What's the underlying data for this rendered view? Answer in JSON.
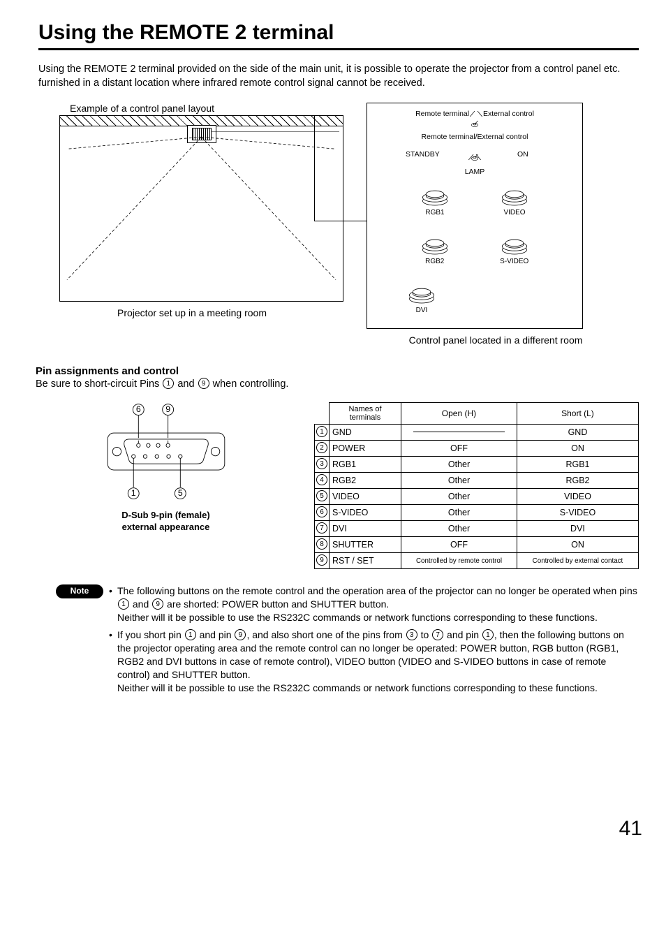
{
  "title": "Using the REMOTE 2 terminal",
  "intro": "Using the REMOTE 2 terminal provided on the side of the main unit, it is possible to operate the projector from a control panel etc. furnished in a distant location where infrared remote control signal cannot be received.",
  "example_label": "Example of a control panel layout",
  "left_caption": "Projector set up in a meeting room",
  "right_caption": "Control panel located in a different room",
  "panel": {
    "top1_left": "Remote terminal",
    "top1_right": "External control",
    "top2": "Remote terminal/External control",
    "standby": "STANDBY",
    "on": "ON",
    "lamp": "LAMP",
    "buttons": [
      "RGB1",
      "VIDEO",
      "RGB2",
      "S-VIDEO",
      "DVI"
    ]
  },
  "section_title": "Pin assignments and control",
  "section_sub_pre": "Be sure to short-circuit Pins ",
  "section_sub_mid": " and ",
  "section_sub_post": " when controlling.",
  "dsub_caption_line1": "D-Sub 9-pin (female)",
  "dsub_caption_line2": "external appearance",
  "dsub_labels": {
    "top_left": "6",
    "top_right": "9",
    "bot_left": "1",
    "bot_right": "5"
  },
  "table_headers": [
    "Names of terminals",
    "Open (H)",
    "Short (L)"
  ],
  "table_rows": [
    {
      "pin": "1",
      "name": "GND",
      "open": "__line__",
      "short": "GND"
    },
    {
      "pin": "2",
      "name": "POWER",
      "open": "OFF",
      "short": "ON"
    },
    {
      "pin": "3",
      "name": "RGB1",
      "open": "Other",
      "short": "RGB1"
    },
    {
      "pin": "4",
      "name": "RGB2",
      "open": "Other",
      "short": "RGB2"
    },
    {
      "pin": "5",
      "name": "VIDEO",
      "open": "Other",
      "short": "VIDEO"
    },
    {
      "pin": "6",
      "name": "S-VIDEO",
      "open": "Other",
      "short": "S-VIDEO"
    },
    {
      "pin": "7",
      "name": "DVI",
      "open": "Other",
      "short": "DVI"
    },
    {
      "pin": "8",
      "name": "SHUTTER",
      "open": "OFF",
      "short": "ON"
    },
    {
      "pin": "9",
      "name": "RST / SET",
      "open": "Controlled by remote control",
      "short": "Controlled by external contact"
    }
  ],
  "note_label": "Note",
  "note1": {
    "a": "The following buttons on the remote control and the operation area of the projector can no longer be operated when pins ",
    "b": " and ",
    "c": " are shorted: POWER button and SHUTTER button.\nNeither will it be possible to use the RS232C commands or network functions corresponding to these functions."
  },
  "note2": {
    "a": "If you short pin ",
    "b": " and pin ",
    "c": ", and also short one of the pins from ",
    "d": " to ",
    "e": " and pin ",
    "f": ", then the following buttons on the projector operating area and the remote control can no longer be operated: POWER button, RGB button (RGB1, RGB2 and DVI buttons in case of remote control), VIDEO button (VIDEO and S-VIDEO buttons in case of remote control) and SHUTTER button.\nNeither will it be possible to use the RS232C commands or network functions corresponding to these functions."
  },
  "pagenum": "41"
}
